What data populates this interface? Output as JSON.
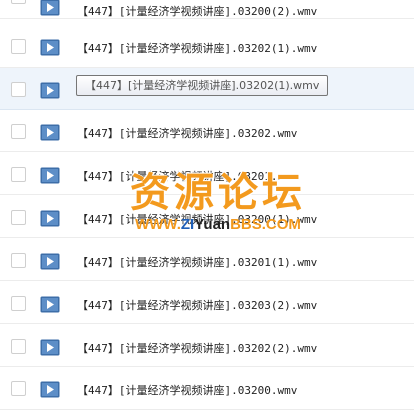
{
  "files": [
    {
      "name": "【447】[计量经济学视频讲座].03200(2).wmv"
    },
    {
      "name": "【447】[计量经济学视频讲座].03202(1).wmv"
    },
    {
      "name": ""
    },
    {
      "name": "【447】[计量经济学视频讲座].03202.wmv"
    },
    {
      "name": "【447】[计量经济学视频讲座].03201.wmv"
    },
    {
      "name": "【447】[计量经济学视频讲座].03200(1).wmv"
    },
    {
      "name": "【447】[计量经济学视频讲座].03201(1).wmv"
    },
    {
      "name": "【447】[计量经济学视频讲座].03203(2).wmv"
    },
    {
      "name": "【447】[计量经济学视频讲座].03202(2).wmv"
    },
    {
      "name": "【447】[计量经济学视频讲座].03200.wmv"
    }
  ],
  "tooltip": {
    "text": "【447】[计量经济学视频讲座].03202(1).wmv"
  },
  "watermark": {
    "title": "资源论坛",
    "sub_www": "WWW.",
    "sub_zi": "ZI",
    "sub_yuan": "Yuan",
    "sub_bbs": "BBS",
    "sub_com": ".COM"
  },
  "colors": {
    "icon_blue": "#3d6ea8",
    "hover_row": "#eef4fb",
    "watermark_orange": "#f39a1e",
    "watermark_blue": "#1f5fb8"
  },
  "icons": {
    "row_file": "video-file-icon",
    "row_select": "checkbox"
  }
}
